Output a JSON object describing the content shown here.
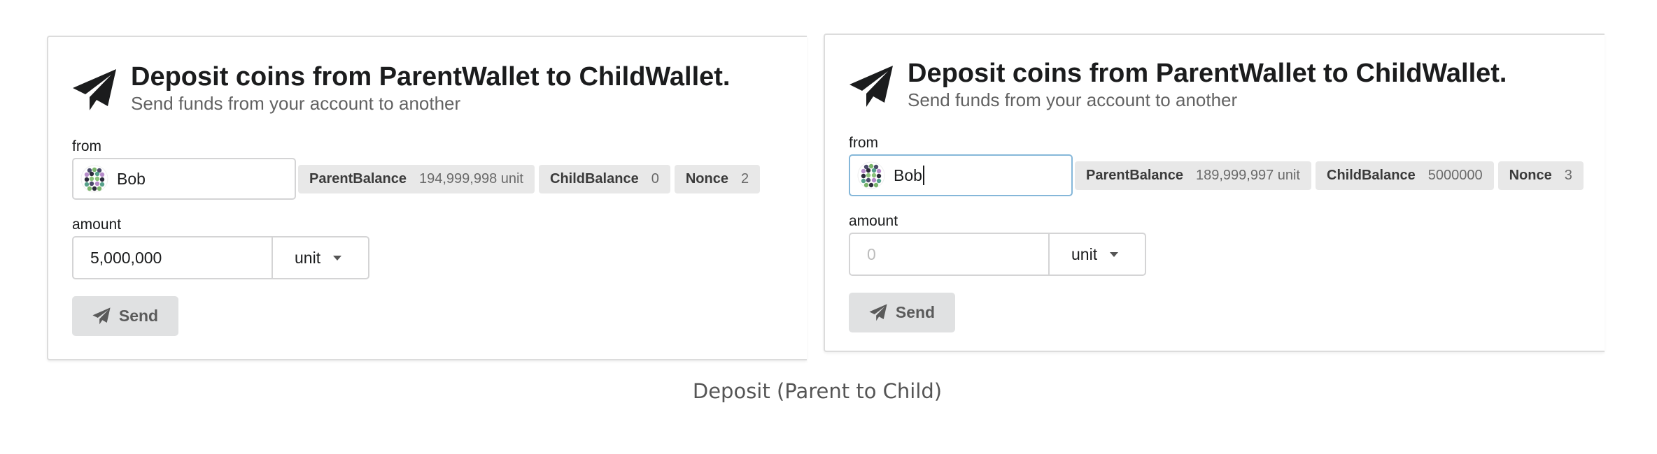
{
  "left": {
    "title": "Deposit coins from ParentWallet to ChildWallet.",
    "subtitle": "Send funds from your account to another",
    "from_label": "from",
    "from_value": "Bob",
    "balances": [
      {
        "key": "ParentBalance",
        "value": "194,999,998 unit"
      },
      {
        "key": "ChildBalance",
        "value": "0"
      },
      {
        "key": "Nonce",
        "value": "2"
      }
    ],
    "amount_label": "amount",
    "amount_value": "5,000,000",
    "unit": "unit",
    "send_label": "Send"
  },
  "right": {
    "title": "Deposit coins from ParentWallet to ChildWallet.",
    "subtitle": "Send funds from your account to another",
    "from_label": "from",
    "from_value": "Bob",
    "balances": [
      {
        "key": "ParentBalance",
        "value": "189,999,997 unit"
      },
      {
        "key": "ChildBalance",
        "value": "5000000"
      },
      {
        "key": "Nonce",
        "value": "3"
      }
    ],
    "amount_label": "amount",
    "amount_placeholder": "0",
    "unit": "unit",
    "send_label": "Send"
  },
  "caption": "Deposit (Parent to Child)",
  "icons": {
    "header": "paper-plane-icon",
    "send": "paper-plane-icon",
    "avatar": "identicon-avatar"
  }
}
